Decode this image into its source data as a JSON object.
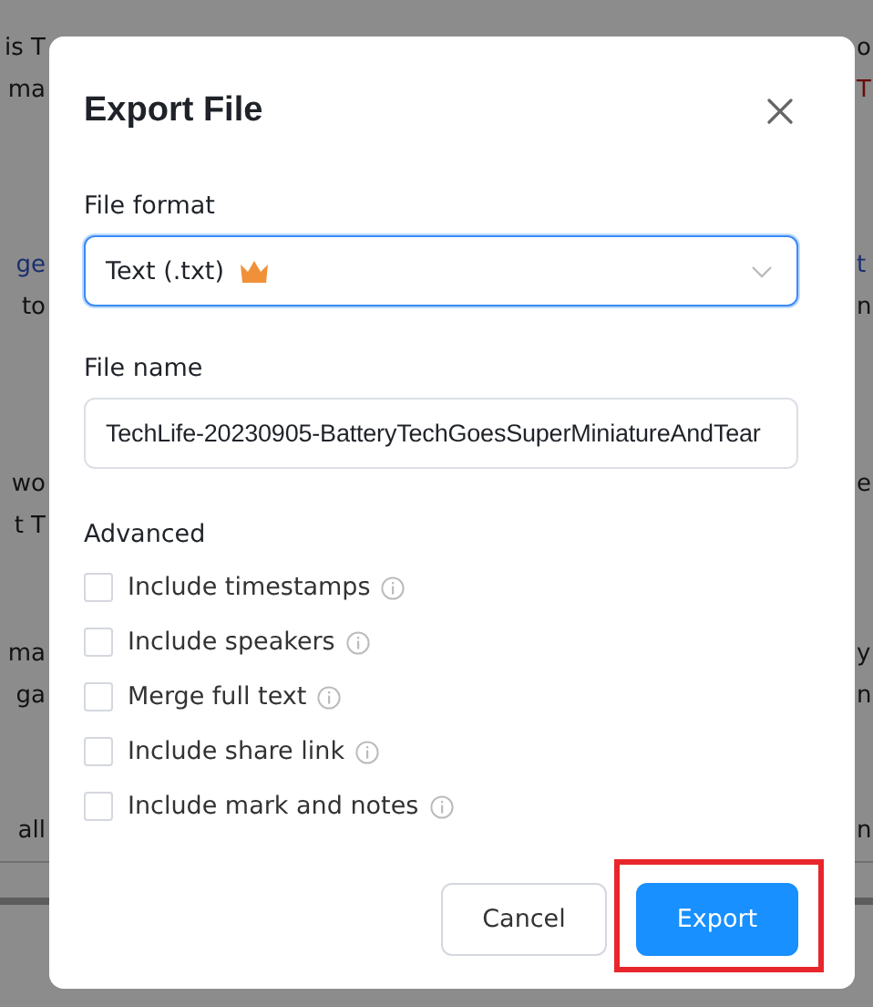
{
  "background": {
    "paragraphs": [
      [
        {
          "left": {
            "text": "is T",
            "kind": "plain"
          },
          "right": {
            "text": "o",
            "kind": "plain"
          }
        },
        {
          "left": {
            "text": "ma",
            "kind": "plain"
          },
          "right": {
            "text": "T",
            "kind": "accent"
          }
        }
      ],
      [
        {
          "left": {
            "text": "ge",
            "kind": "link"
          },
          "right": {
            "text": "t",
            "kind": "link"
          }
        },
        {
          "left": {
            "text": "to",
            "kind": "plain"
          },
          "right": {
            "text": "n",
            "kind": "plain"
          }
        }
      ],
      [
        {
          "left": {
            "text": "wo",
            "kind": "plain"
          },
          "right": {
            "text": "e",
            "kind": "plain"
          }
        },
        {
          "left": {
            "text": "t T",
            "kind": "plain"
          }
        }
      ],
      [
        {
          "left": {
            "text": "ma",
            "kind": "plain"
          },
          "right": {
            "text": "y",
            "kind": "plain"
          }
        },
        {
          "left": {
            "text": "ga",
            "kind": "plain"
          },
          "right": {
            "text": "n",
            "kind": "plain"
          }
        }
      ],
      [
        {
          "left": {
            "text": "all",
            "kind": "plain"
          },
          "right": {
            "text": "n",
            "kind": "plain"
          }
        }
      ]
    ]
  },
  "dialog": {
    "title": "Export File",
    "fields": [
      {
        "kind": "select",
        "label": "File format",
        "value": "Text (.txt)",
        "premium": true,
        "focused": true
      },
      {
        "kind": "text",
        "label": "File name",
        "value": "TechLife-20230905-BatteryTechGoesSuperMiniatureAndTear",
        "focused": false
      }
    ],
    "advanced": {
      "heading": "Advanced",
      "options": [
        {
          "label": "Include timestamps",
          "checked": false
        },
        {
          "label": "Include speakers",
          "checked": false
        },
        {
          "label": "Merge full text",
          "checked": false
        },
        {
          "label": "Include share link",
          "checked": false
        },
        {
          "label": "Include mark and notes",
          "checked": false
        }
      ]
    },
    "buttons": [
      {
        "label": "Cancel",
        "kind": "secondary"
      },
      {
        "label": "Export",
        "kind": "primary",
        "highlighted": true
      }
    ]
  }
}
